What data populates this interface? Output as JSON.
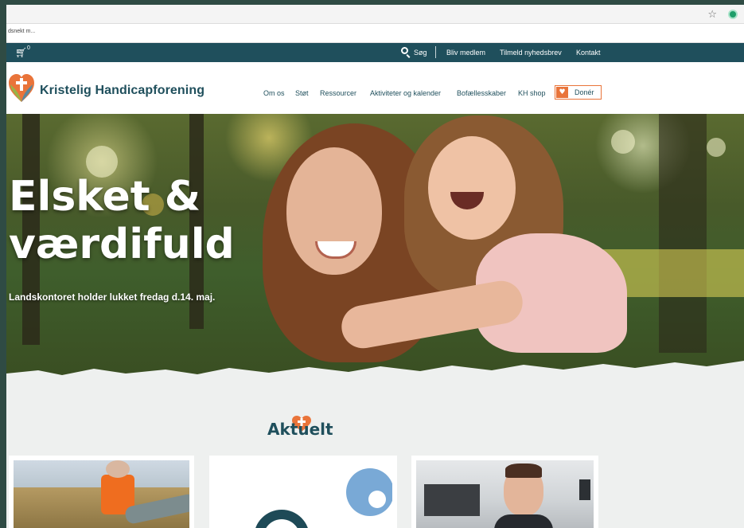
{
  "browser": {
    "tab_text": "dsnekt m...",
    "icons": [
      "star-icon",
      "extension-icon"
    ]
  },
  "topbar": {
    "cart_count": "0",
    "search_label": "Søg",
    "links": [
      "Bliv medlem",
      "Tilmeld nyhedsbrev",
      "Kontakt"
    ]
  },
  "header": {
    "logo_text": "Kristelig Handicapforening",
    "nav": [
      "Om os",
      "Støt",
      "Ressourcer",
      "Aktiviteter og kalender",
      "Bofællesskaber",
      "KH shop"
    ],
    "donate_label": "Donér"
  },
  "hero": {
    "title": "Elsket & værdifuld",
    "subtitle": "Landskontoret holder lukket fredag d.14. maj."
  },
  "news": {
    "title": "Aktuelt"
  },
  "colors": {
    "brand": "#1f4f5c",
    "accent": "#e9743a",
    "background": "#eef0ef"
  }
}
